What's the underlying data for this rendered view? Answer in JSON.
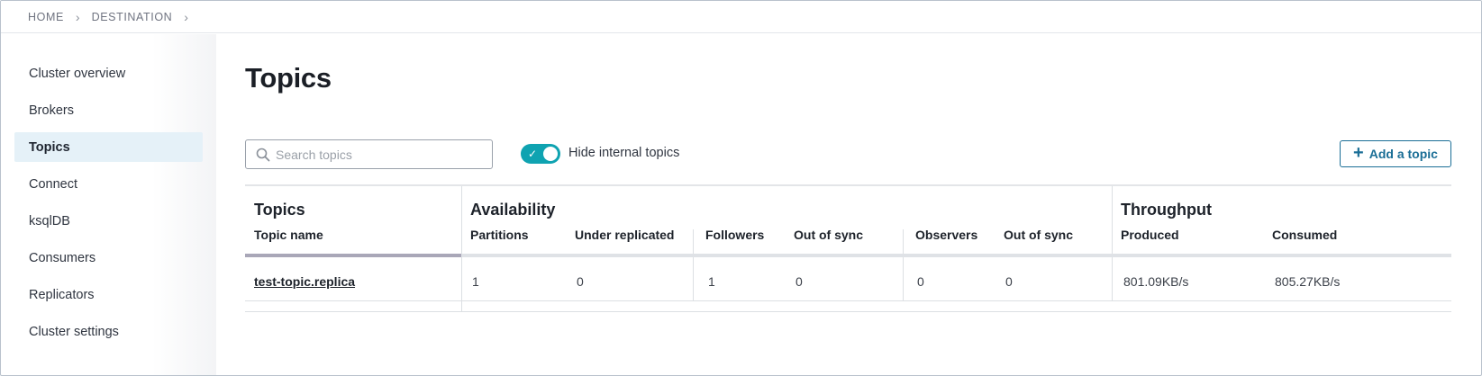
{
  "breadcrumb": {
    "items": [
      "HOME",
      "DESTINATION"
    ],
    "separator": "›"
  },
  "sidebar": {
    "items": [
      {
        "label": "Cluster overview",
        "active": false
      },
      {
        "label": "Brokers",
        "active": false
      },
      {
        "label": "Topics",
        "active": true
      },
      {
        "label": "Connect",
        "active": false
      },
      {
        "label": "ksqlDB",
        "active": false
      },
      {
        "label": "Consumers",
        "active": false
      },
      {
        "label": "Replicators",
        "active": false
      },
      {
        "label": "Cluster settings",
        "active": false
      }
    ]
  },
  "main": {
    "title": "Topics",
    "search": {
      "placeholder": "Search topics",
      "value": "",
      "icon": "search-icon"
    },
    "toggle": {
      "label": "Hide internal topics",
      "checked": true,
      "icon": "check-icon"
    },
    "add_button": {
      "label": "Add a topic",
      "icon": "plus-icon"
    }
  },
  "table": {
    "groups": {
      "topics": "Topics",
      "availability": "Availability",
      "throughput": "Throughput"
    },
    "columns": {
      "topic_name": "Topic name",
      "partitions": "Partitions",
      "under_replicated": "Under replicated",
      "followers": "Followers",
      "out_of_sync_followers": "Out of sync",
      "observers": "Observers",
      "out_of_sync_observers": "Out of sync",
      "produced": "Produced",
      "consumed": "Consumed"
    },
    "rows": [
      {
        "topic_name": "test-topic.replica",
        "partitions": "1",
        "under_replicated": "0",
        "followers": "1",
        "out_of_sync_followers": "0",
        "observers": "0",
        "out_of_sync_observers": "0",
        "produced": "801.09KB/s",
        "consumed": "805.27KB/s"
      }
    ]
  },
  "colors": {
    "accent": "#0fa3b1",
    "button": "#1a6e96",
    "active_nav_bg": "#e5f1f8"
  }
}
